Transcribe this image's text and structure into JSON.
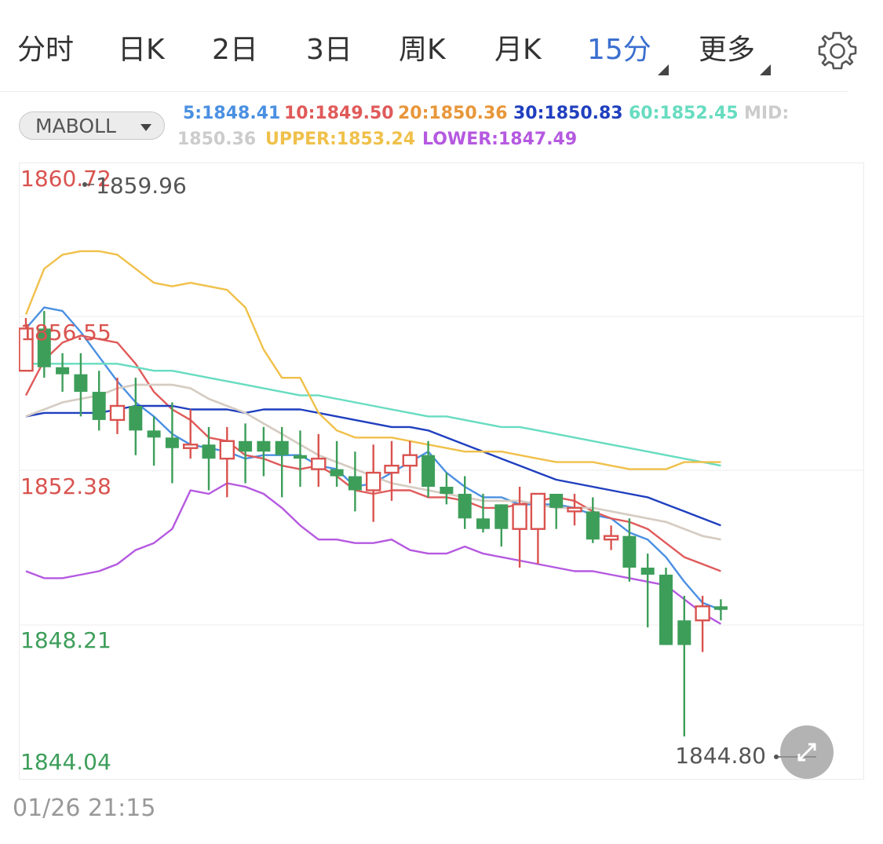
{
  "tabs": [
    {
      "label": "分时"
    },
    {
      "label": "日K"
    },
    {
      "label": "2日"
    },
    {
      "label": "3日"
    },
    {
      "label": "周K"
    },
    {
      "label": "月K"
    },
    {
      "label": "15分",
      "active": true,
      "dropdown": true
    },
    {
      "label": "更多",
      "dropdown": true
    }
  ],
  "settings_icon": "gear-icon",
  "indicator": {
    "selector_label": "MABOLL",
    "values": [
      {
        "text": "5:1848.41",
        "color": "#4a90e2"
      },
      {
        "text": "10:1849.50",
        "color": "#e05a5a"
      },
      {
        "text": "20:1850.36",
        "color": "#e8963a"
      },
      {
        "text": "30:1850.83",
        "color": "#1f3fbf"
      },
      {
        "text": "60:1852.45",
        "color": "#67dcc0"
      },
      {
        "text": "MID:",
        "color": "#cccccc"
      },
      {
        "text": "1850.36",
        "color": "#cccccc"
      },
      {
        "text": "UPPER:1853.24",
        "color": "#f0c04a"
      },
      {
        "text": "LOWER:1847.49",
        "color": "#b559e0"
      }
    ]
  },
  "chart_data": {
    "type": "candlestick",
    "interval": "15分",
    "y_axis": {
      "ticks": [
        {
          "label": "1860.72",
          "value": 1860.72,
          "color": "#d9534f"
        },
        {
          "label": "1856.55",
          "value": 1856.55,
          "color": "#d9534f"
        },
        {
          "label": "1852.38",
          "value": 1852.38,
          "color": "#d9534f"
        },
        {
          "label": "1848.21",
          "value": 1848.21,
          "color": "#3d9e5a"
        },
        {
          "label": "1844.04",
          "value": 1844.04,
          "color": "#3d9e5a"
        }
      ],
      "ylim": [
        1844.04,
        1860.72
      ]
    },
    "annotations": [
      {
        "label": "1859.96",
        "value": 1859.96,
        "type": "high"
      },
      {
        "label": "1844.80",
        "value": 1844.8,
        "type": "low"
      }
    ],
    "candles": [
      {
        "open": 1855.2,
        "high": 1856.7,
        "low": 1855.2,
        "close": 1856.4,
        "dir": "up"
      },
      {
        "open": 1856.4,
        "high": 1856.9,
        "low": 1855.0,
        "close": 1855.3,
        "dir": "down"
      },
      {
        "open": 1855.3,
        "high": 1855.7,
        "low": 1854.6,
        "close": 1855.1,
        "dir": "down"
      },
      {
        "open": 1855.1,
        "high": 1855.7,
        "low": 1853.9,
        "close": 1854.6,
        "dir": "down"
      },
      {
        "open": 1854.6,
        "high": 1855.2,
        "low": 1853.5,
        "close": 1853.8,
        "dir": "down"
      },
      {
        "open": 1853.8,
        "high": 1855.0,
        "low": 1853.4,
        "close": 1854.2,
        "dir": "up"
      },
      {
        "open": 1854.2,
        "high": 1855.0,
        "low": 1852.8,
        "close": 1853.5,
        "dir": "down"
      },
      {
        "open": 1853.5,
        "high": 1853.9,
        "low": 1852.5,
        "close": 1853.3,
        "dir": "down"
      },
      {
        "open": 1853.3,
        "high": 1854.3,
        "low": 1852.0,
        "close": 1853.0,
        "dir": "down"
      },
      {
        "open": 1853.0,
        "high": 1854.1,
        "low": 1852.7,
        "close": 1853.1,
        "dir": "up"
      },
      {
        "open": 1853.1,
        "high": 1853.6,
        "low": 1851.8,
        "close": 1852.7,
        "dir": "down"
      },
      {
        "open": 1852.7,
        "high": 1853.6,
        "low": 1851.6,
        "close": 1853.2,
        "dir": "up"
      },
      {
        "open": 1853.2,
        "high": 1853.7,
        "low": 1852.0,
        "close": 1852.9,
        "dir": "down"
      },
      {
        "open": 1852.9,
        "high": 1853.6,
        "low": 1852.2,
        "close": 1853.2,
        "dir": "down"
      },
      {
        "open": 1853.2,
        "high": 1853.6,
        "low": 1851.6,
        "close": 1852.8,
        "dir": "down"
      },
      {
        "open": 1852.8,
        "high": 1853.5,
        "low": 1851.9,
        "close": 1852.7,
        "dir": "down"
      },
      {
        "open": 1852.7,
        "high": 1853.4,
        "low": 1851.9,
        "close": 1852.4,
        "dir": "up"
      },
      {
        "open": 1852.4,
        "high": 1853.2,
        "low": 1851.9,
        "close": 1852.2,
        "dir": "down"
      },
      {
        "open": 1852.2,
        "high": 1852.9,
        "low": 1851.2,
        "close": 1851.8,
        "dir": "down"
      },
      {
        "open": 1851.8,
        "high": 1853.1,
        "low": 1850.9,
        "close": 1852.3,
        "dir": "up"
      },
      {
        "open": 1852.3,
        "high": 1853.2,
        "low": 1851.5,
        "close": 1852.5,
        "dir": "up"
      },
      {
        "open": 1852.5,
        "high": 1853.2,
        "low": 1852.0,
        "close": 1852.8,
        "dir": "up"
      },
      {
        "open": 1852.8,
        "high": 1853.2,
        "low": 1851.6,
        "close": 1851.9,
        "dir": "down"
      },
      {
        "open": 1851.9,
        "high": 1852.3,
        "low": 1851.4,
        "close": 1851.7,
        "dir": "down"
      },
      {
        "open": 1851.7,
        "high": 1852.2,
        "low": 1850.7,
        "close": 1851.0,
        "dir": "down"
      },
      {
        "open": 1851.0,
        "high": 1851.7,
        "low": 1850.6,
        "close": 1850.7,
        "dir": "down"
      },
      {
        "open": 1850.7,
        "high": 1851.3,
        "low": 1850.2,
        "close": 1851.4,
        "dir": "down"
      },
      {
        "open": 1851.4,
        "high": 1851.9,
        "low": 1849.6,
        "close": 1850.7,
        "dir": "up"
      },
      {
        "open": 1850.7,
        "high": 1851.4,
        "low": 1849.7,
        "close": 1851.7,
        "dir": "up"
      },
      {
        "open": 1851.7,
        "high": 1851.6,
        "low": 1850.7,
        "close": 1851.3,
        "dir": "down"
      },
      {
        "open": 1851.3,
        "high": 1851.7,
        "low": 1850.8,
        "close": 1851.2,
        "dir": "up"
      },
      {
        "open": 1851.2,
        "high": 1851.6,
        "low": 1850.3,
        "close": 1850.4,
        "dir": "down"
      },
      {
        "open": 1850.4,
        "high": 1850.8,
        "low": 1850.1,
        "close": 1850.5,
        "dir": "up"
      },
      {
        "open": 1850.5,
        "high": 1851.0,
        "low": 1849.2,
        "close": 1849.6,
        "dir": "down"
      },
      {
        "open": 1849.6,
        "high": 1850.0,
        "low": 1847.9,
        "close": 1849.4,
        "dir": "down"
      },
      {
        "open": 1849.4,
        "high": 1849.6,
        "low": 1848.4,
        "close": 1847.4,
        "dir": "down"
      },
      {
        "open": 1847.4,
        "high": 1848.8,
        "low": 1844.8,
        "close": 1848.1,
        "dir": "down"
      },
      {
        "open": 1848.1,
        "high": 1848.8,
        "low": 1847.2,
        "close": 1848.5,
        "dir": "up"
      },
      {
        "open": 1848.5,
        "high": 1848.7,
        "low": 1848.1,
        "close": 1848.4,
        "dir": "down"
      }
    ],
    "series": [
      {
        "name": "5",
        "color": "#4a90e2",
        "values": [
          1856.4,
          1857.0,
          1856.9,
          1856.3,
          1855.6,
          1854.9,
          1854.3,
          1853.9,
          1853.4,
          1853.1,
          1853.0,
          1852.9,
          1852.7,
          1852.8,
          1852.8,
          1852.8,
          1852.5,
          1852.4,
          1851.9,
          1852.0,
          1852.3,
          1852.6,
          1852.9,
          1852.3,
          1851.9,
          1851.6,
          1851.6,
          1851.4,
          1851.4,
          1851.4,
          1851.3,
          1851.1,
          1851.0,
          1850.6,
          1850.4,
          1849.9,
          1849.2,
          1848.6,
          1848.4
        ]
      },
      {
        "name": "10",
        "color": "#e05a5a",
        "values": [
          1854.5,
          1855.5,
          1856.0,
          1856.2,
          1856.1,
          1856.0,
          1855.4,
          1854.6,
          1854.1,
          1853.8,
          1853.3,
          1853.2,
          1852.8,
          1852.7,
          1852.5,
          1852.4,
          1852.5,
          1852.2,
          1851.8,
          1851.7,
          1851.8,
          1851.8,
          1851.6,
          1851.6,
          1851.5,
          1851.3,
          1851.3,
          1851.4,
          1851.5,
          1851.6,
          1851.5,
          1851.2,
          1851.0,
          1850.9,
          1850.7,
          1850.3,
          1849.9,
          1849.7,
          1849.5
        ]
      },
      {
        "name": "20",
        "color": "#e8963a",
        "values": [
          1853.9,
          1854.1,
          1854.3,
          1854.4,
          1854.5,
          1854.7,
          1854.8,
          1854.8,
          1854.8,
          1854.7,
          1854.4,
          1854.2,
          1854.0,
          1853.7,
          1853.4,
          1853.1,
          1852.8,
          1852.6,
          1852.4,
          1852.2,
          1852.0,
          1851.9,
          1851.8,
          1851.7,
          1851.6,
          1851.5,
          1851.5,
          1851.5,
          1851.4,
          1851.3,
          1851.3,
          1851.3,
          1851.2,
          1851.1,
          1851.0,
          1850.9,
          1850.7,
          1850.5,
          1850.4
        ]
      },
      {
        "name": "30",
        "color": "#1f3fbf",
        "values": [
          1853.9,
          1854.0,
          1854.0,
          1854.0,
          1854.0,
          1854.1,
          1854.2,
          1854.2,
          1854.2,
          1854.1,
          1854.1,
          1854.1,
          1854.0,
          1854.1,
          1854.1,
          1854.1,
          1854.0,
          1853.9,
          1853.8,
          1853.7,
          1853.6,
          1853.6,
          1853.5,
          1853.3,
          1853.1,
          1852.9,
          1852.7,
          1852.5,
          1852.3,
          1852.1,
          1852.0,
          1851.9,
          1851.8,
          1851.7,
          1851.6,
          1851.4,
          1851.2,
          1851.0,
          1850.8
        ]
      },
      {
        "name": "60",
        "color": "#67dcc0",
        "values": [
          1855.4,
          1855.4,
          1855.4,
          1855.4,
          1855.4,
          1855.4,
          1855.3,
          1855.2,
          1855.2,
          1855.1,
          1855.0,
          1854.9,
          1854.8,
          1854.7,
          1854.6,
          1854.5,
          1854.5,
          1854.4,
          1854.3,
          1854.2,
          1854.1,
          1854.0,
          1853.9,
          1853.9,
          1853.8,
          1853.7,
          1853.6,
          1853.6,
          1853.5,
          1853.4,
          1853.3,
          1853.2,
          1853.1,
          1853.0,
          1852.9,
          1852.8,
          1852.7,
          1852.6,
          1852.5
        ]
      },
      {
        "name": "MID",
        "color": "#d3cdc8",
        "values": [
          1853.9,
          1854.1,
          1854.3,
          1854.4,
          1854.5,
          1854.7,
          1854.8,
          1854.8,
          1854.8,
          1854.7,
          1854.4,
          1854.2,
          1854.0,
          1853.7,
          1853.4,
          1853.1,
          1852.8,
          1852.6,
          1852.4,
          1852.2,
          1852.0,
          1851.9,
          1851.8,
          1851.7,
          1851.6,
          1851.5,
          1851.5,
          1851.5,
          1851.4,
          1851.3,
          1851.3,
          1851.3,
          1851.2,
          1851.1,
          1851.0,
          1850.9,
          1850.7,
          1850.5,
          1850.4
        ]
      },
      {
        "name": "UPPER",
        "color": "#f0c04a",
        "values": [
          1856.8,
          1858.1,
          1858.5,
          1858.6,
          1858.6,
          1858.5,
          1858.1,
          1857.7,
          1857.6,
          1857.7,
          1857.6,
          1857.5,
          1857.0,
          1855.8,
          1855.0,
          1855.0,
          1854.0,
          1853.5,
          1853.3,
          1853.3,
          1853.3,
          1853.2,
          1853.1,
          1853.0,
          1852.9,
          1852.9,
          1852.9,
          1852.8,
          1852.7,
          1852.6,
          1852.6,
          1852.6,
          1852.5,
          1852.4,
          1852.4,
          1852.4,
          1852.6,
          1852.6,
          1852.6
        ]
      },
      {
        "name": "LOWER",
        "color": "#b559e0",
        "values": [
          1849.5,
          1849.3,
          1849.3,
          1849.4,
          1849.5,
          1849.7,
          1850.1,
          1850.3,
          1850.7,
          1851.8,
          1851.7,
          1852.0,
          1851.9,
          1851.7,
          1851.3,
          1850.8,
          1850.4,
          1850.4,
          1850.3,
          1850.3,
          1850.4,
          1850.1,
          1850.0,
          1850.0,
          1850.2,
          1850.0,
          1849.9,
          1849.8,
          1849.7,
          1849.6,
          1849.5,
          1849.5,
          1849.4,
          1849.3,
          1849.2,
          1849.1,
          1848.7,
          1848.3,
          1848.0
        ]
      }
    ],
    "colors": {
      "up": "#d9534f",
      "down": "#3d9e5a",
      "grid": "#ececec",
      "axis_text_up": "#d9534f",
      "axis_text_down": "#3d9e5a"
    },
    "grid": true,
    "timestamp_label": "01/26 21:15"
  },
  "zoom_icon": "expand-icon"
}
